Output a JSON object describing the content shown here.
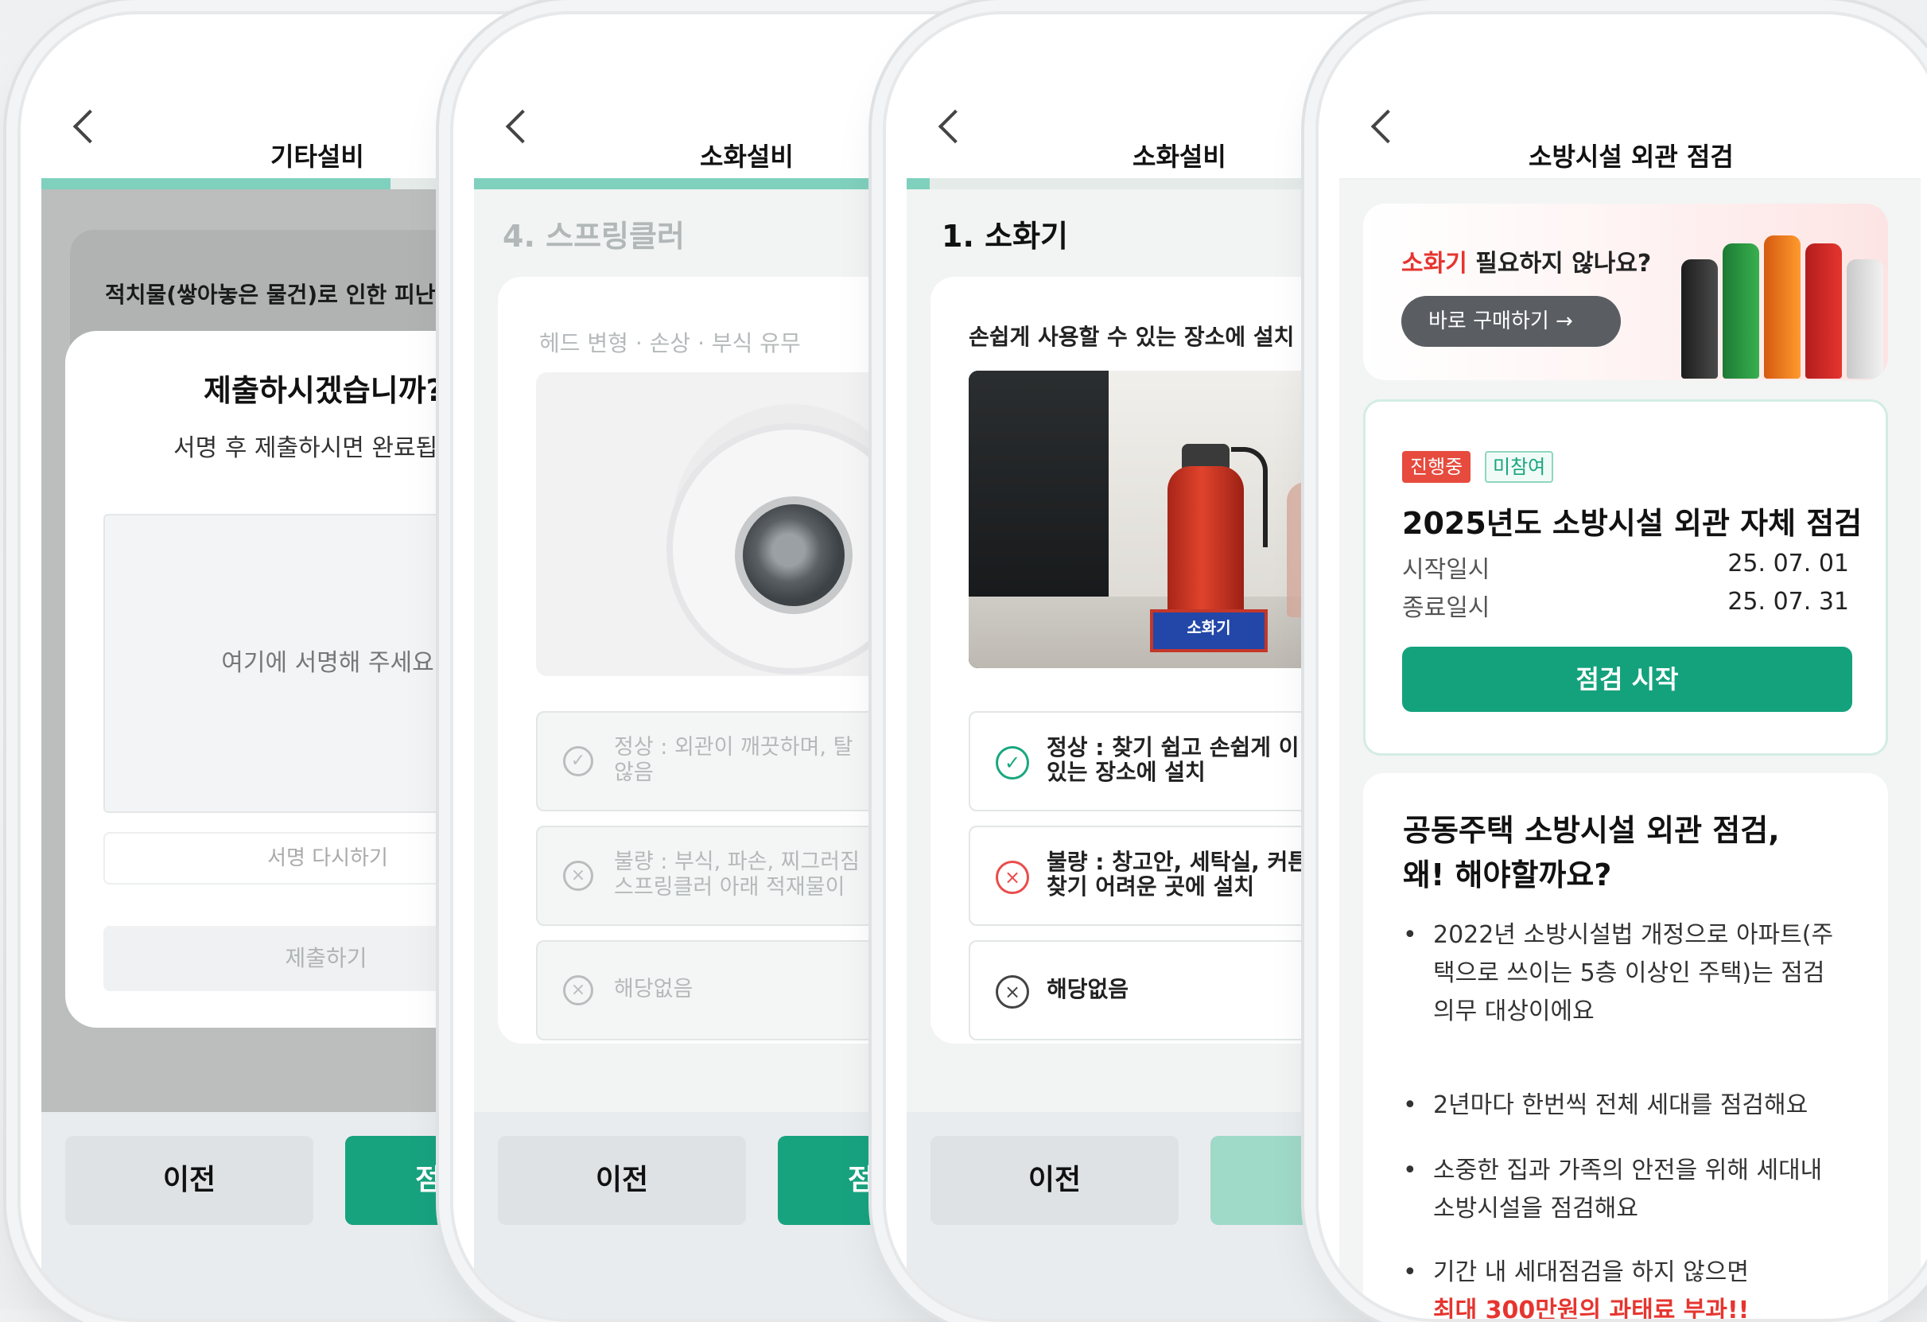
{
  "screen1": {
    "title": "기타설비",
    "question": "적치물(쌓아놓은 물건)로 인한 피난",
    "modal_title": "제출하시겠습니까?",
    "modal_subtitle": "서명 후 제출하시면 완료됩니",
    "signature_placeholder": "여기에 서명해 주세요",
    "resign_label": "서명 다시하기",
    "submit_label": "제출하기",
    "prev_label": "이전",
    "next_label": "점검"
  },
  "screen2": {
    "title": "소화설비",
    "section_title": "4. 스프링클러",
    "question": "헤드 변형 · 손상 · 부식 유무",
    "options": [
      {
        "line1": "정상 : 외관이 깨끗하며, 탈",
        "line2": "않음",
        "icon": "✓"
      },
      {
        "line1": "불량 : 부식, 파손, 찌그러짐",
        "line2": "스프링클러 아래 적재물이",
        "icon": "×"
      },
      {
        "line1": "해당없음",
        "line2": "",
        "icon": "×"
      }
    ],
    "prev_label": "이전",
    "next_label": "점검"
  },
  "screen3": {
    "title": "소화설비",
    "section_title": "1. 소화기",
    "question": "손쉽게 사용할 수 있는 장소에 설치",
    "photo_label": "소화기",
    "options": [
      {
        "line1": "정상 : 찾기 쉽고 손쉽게 이",
        "line2": "있는 장소에 설치",
        "icon": "✓"
      },
      {
        "line1": "불량 : 창고안, 세탁실, 커튼",
        "line2": "찾기 어려운 곳에 설치",
        "icon": "×"
      },
      {
        "line1": "해당없음",
        "line2": "",
        "icon": "×"
      }
    ],
    "prev_label": "이전"
  },
  "screen4": {
    "title": "소방시설 외관 점검",
    "banner": {
      "highlight": "소화기",
      "text": " 필요하지 않나요?",
      "buy_label": "바로 구매하기 →"
    },
    "card": {
      "tag_status": "진행중",
      "tag_participation": "미참여",
      "title": "2025년도 소방시설 외관 자체 점검",
      "start_label": "시작일시",
      "start_value": "25. 07. 01",
      "end_label": "종료일시",
      "end_value": "25. 07. 31",
      "button": "점검 시작"
    },
    "info": {
      "heading1": "공동주택 소방시설 외관 점검,",
      "heading2": "왜! 해야할까요?",
      "bullets": [
        [
          "2022년 소방시설법 개정으로 아파트(주",
          "택으로 쓰이는 5층 이상인 주택)는 점검",
          "의무 대상이에요"
        ],
        [
          "2년마다 한번씩 전체 세대를 점검해요"
        ],
        [
          "소중한 집과 가족의 안전을 위해 세대내",
          "소방시설을 점검해요"
        ],
        [
          "기간 내 세대점검을 하지 않으면"
        ]
      ],
      "penalty": "최대 300만원의 과태료 부과!!"
    }
  },
  "colors": {
    "accent": "#18a37f",
    "progress": "#7fd0bd",
    "danger": "#e6352f"
  }
}
